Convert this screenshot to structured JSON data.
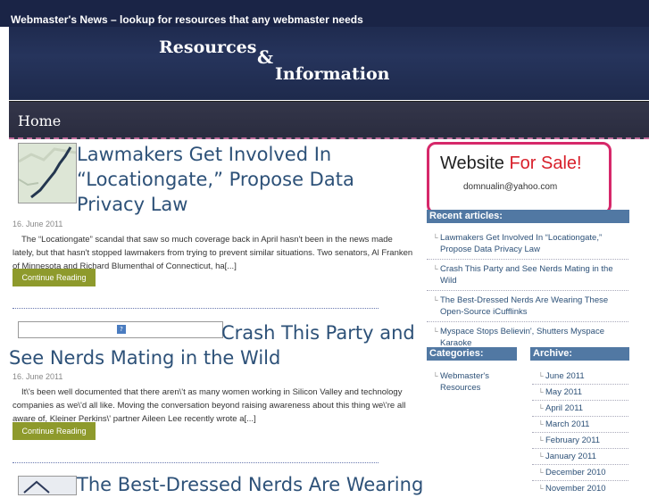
{
  "header": {
    "site_title": "Webmaster's News – lookup for resources that any webmaster needs",
    "logo_line1": "Resources",
    "logo_amp": "&",
    "logo_line2": "Information"
  },
  "nav": {
    "home": "Home"
  },
  "posts": [
    {
      "title": "Lawmakers Get Involved In “Locationgate,” Propose Data Privacy Law",
      "date": "16. June 2011",
      "excerpt": "The “Locationgate” scandal that saw so much coverage back in April hasn't been in the news made lately, but that hasn't stopped lawmakers from trying to prevent similar situations. Two senators, Al Franken of Minnesota and Richard Blumenthal of Connecticut, ha[...]",
      "button": "Continue Reading"
    },
    {
      "title": "Crash This Party and See Nerds Mating in the Wild",
      "date": "16. June 2011",
      "excerpt": "It\\'s been well documented that there aren\\'t as many women working in Silicon Valley and technology companies as we\\'d all like. Moving the conversation beyond raising awareness about this thing we\\'re all aware of, Kleiner Perkins\\' partner Aileen Lee recently wrote a[...]",
      "button": "Continue Reading"
    },
    {
      "title": "The Best-Dressed Nerds Are Wearing"
    }
  ],
  "sidebar": {
    "ad": {
      "head_black": "Website ",
      "head_red": "For Sale!",
      "email": "domnualin@yahoo.com"
    },
    "recent_title": "Recent articles:",
    "recent": [
      "Lawmakers Get Involved In “Locationgate,” Propose Data Privacy Law",
      "Crash This Party and See Nerds Mating in the Wild",
      "The Best-Dressed Nerds Are Wearing These Open-Source iCufflinks",
      "Myspace Stops Believin', Shutters Myspace Karaoke"
    ],
    "categories_title": "Categories:",
    "categories": [
      "Webmaster's Resources"
    ],
    "archive_title": "Archive:",
    "archive": [
      "June 2011",
      "May 2011",
      "April 2011",
      "March 2011",
      "February 2011",
      "January 2011",
      "December 2010",
      "November 2010"
    ]
  },
  "colors": {
    "link": "#2d5178",
    "widget_bg": "#5178a3",
    "button_bg": "#8e9a2c",
    "ad_border": "#d6286a"
  }
}
